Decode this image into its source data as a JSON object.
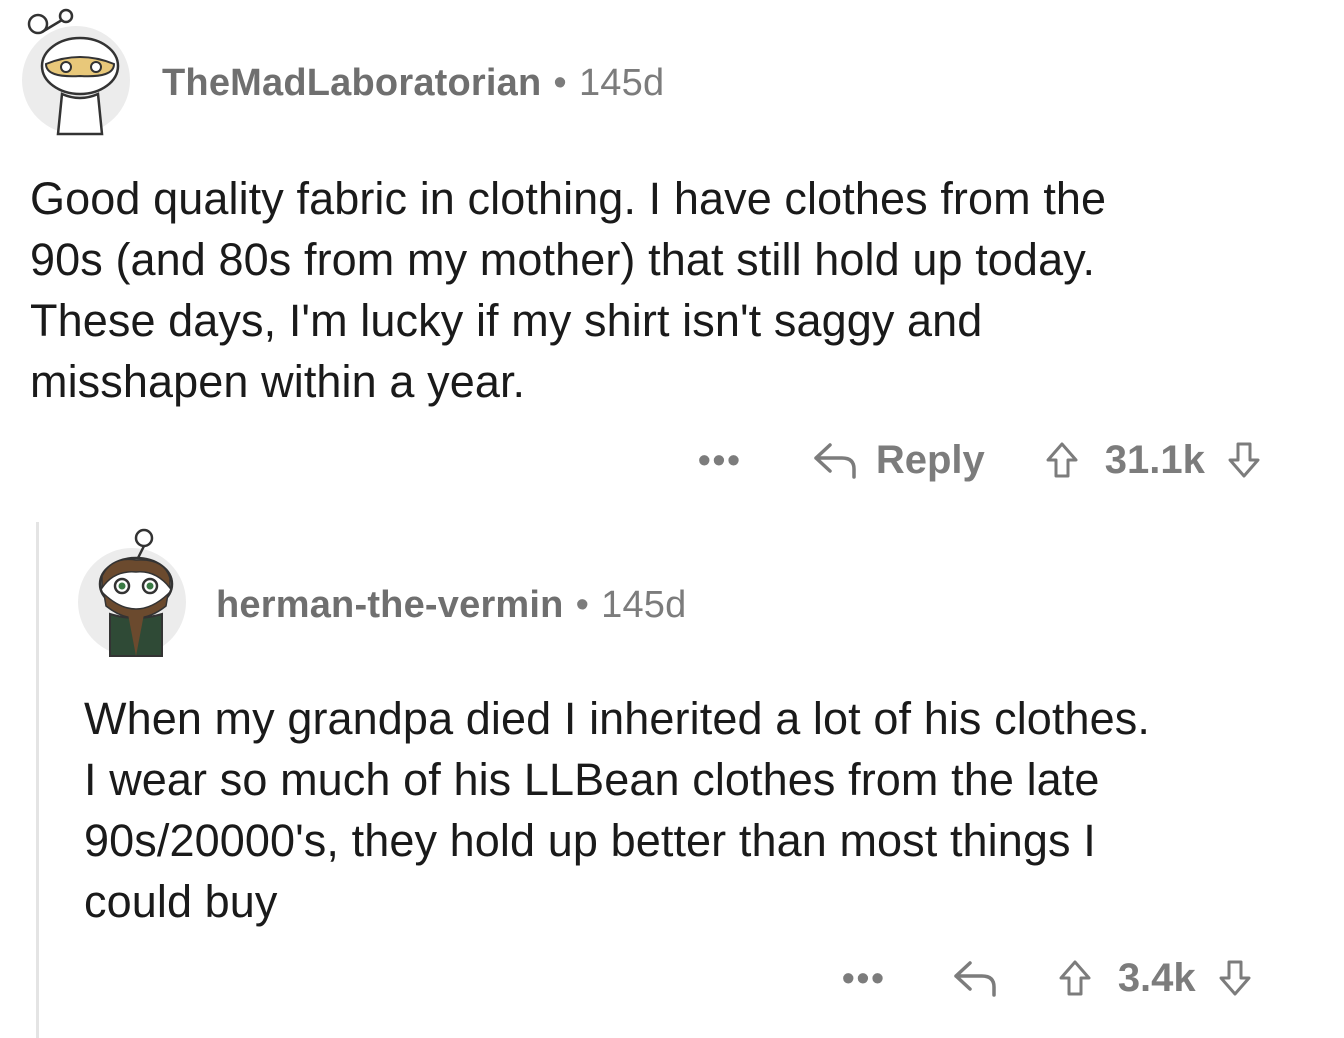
{
  "comments": [
    {
      "username": "TheMadLaboratorian",
      "age": "145d",
      "body": [
        "Good quality fabric in clothing.  I have clothes from the",
        "90s (and 80s from my mother) that still hold up today.",
        "These days, I'm lucky if my shirt isn't saggy and",
        "misshapen within a year."
      ],
      "more_label": "•••",
      "reply_label": "Reply",
      "score": "31.1k"
    },
    {
      "username": "herman-the-vermin",
      "age": "145d",
      "body": [
        "When my grandpa died I inherited a lot of his clothes.",
        "I wear so much of his LLBean clothes from the late",
        "90s/20000's, they hold up better than most things I",
        "could buy"
      ],
      "more_label": "•••",
      "score": "3.4k"
    }
  ],
  "separator": "•",
  "icons": [
    "snoo-avatar",
    "reply-arrow-icon",
    "upvote-icon",
    "downvote-icon"
  ]
}
